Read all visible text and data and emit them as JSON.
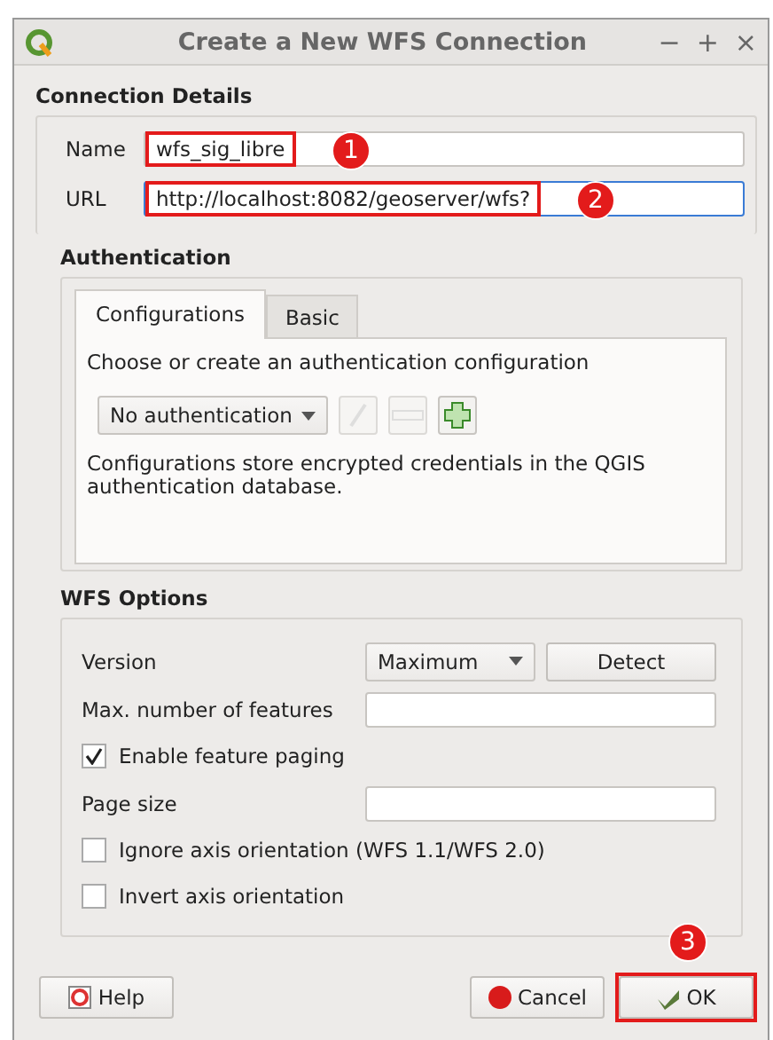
{
  "window": {
    "title": "Create a New WFS Connection",
    "controls": [
      "−",
      "+",
      "×"
    ]
  },
  "connection_details": {
    "title": "Connection Details",
    "fields": [
      {
        "label": "Name",
        "value": "wfs_sig_libre",
        "focused": false,
        "highlighted": true,
        "callout": "1"
      },
      {
        "label": "URL",
        "value": "http://localhost:8082/geoserver/wfs?",
        "focused": true,
        "highlighted": true,
        "callout": "2"
      }
    ]
  },
  "authentication": {
    "title": "Authentication",
    "tabs": [
      {
        "label": "Configurations",
        "selected": true
      },
      {
        "label": "Basic",
        "selected": false
      }
    ],
    "prompt": "Choose or create an authentication configuration",
    "config_select": {
      "value": "No authentication"
    },
    "tool_buttons": [
      {
        "kind": "edit",
        "disabled": true
      },
      {
        "kind": "remove",
        "disabled": true
      },
      {
        "kind": "add",
        "disabled": false
      }
    ],
    "note": "Configurations store encrypted credentials in the QGIS authentication database."
  },
  "wfs_options": {
    "title": "WFS Options",
    "rows": [
      {
        "kind": "select",
        "label": "Version",
        "value": "Maximum",
        "button": "Detect"
      },
      {
        "kind": "input",
        "label": "Max. number of features"
      },
      {
        "kind": "checkbox",
        "label": "Enable feature paging",
        "checked": true
      },
      {
        "kind": "input",
        "label": "Page size"
      },
      {
        "kind": "checkbox",
        "label": "Ignore axis orientation (WFS 1.1/WFS 2.0)",
        "checked": false
      },
      {
        "kind": "checkbox",
        "label": "Invert axis orientation",
        "checked": false
      }
    ]
  },
  "buttons": [
    {
      "kind": "help",
      "label": "Help",
      "highlighted": false
    },
    {
      "kind": "cancel",
      "label": "Cancel",
      "highlighted": false
    },
    {
      "kind": "ok",
      "label": "OK",
      "highlighted": true,
      "callout": "3"
    }
  ]
}
